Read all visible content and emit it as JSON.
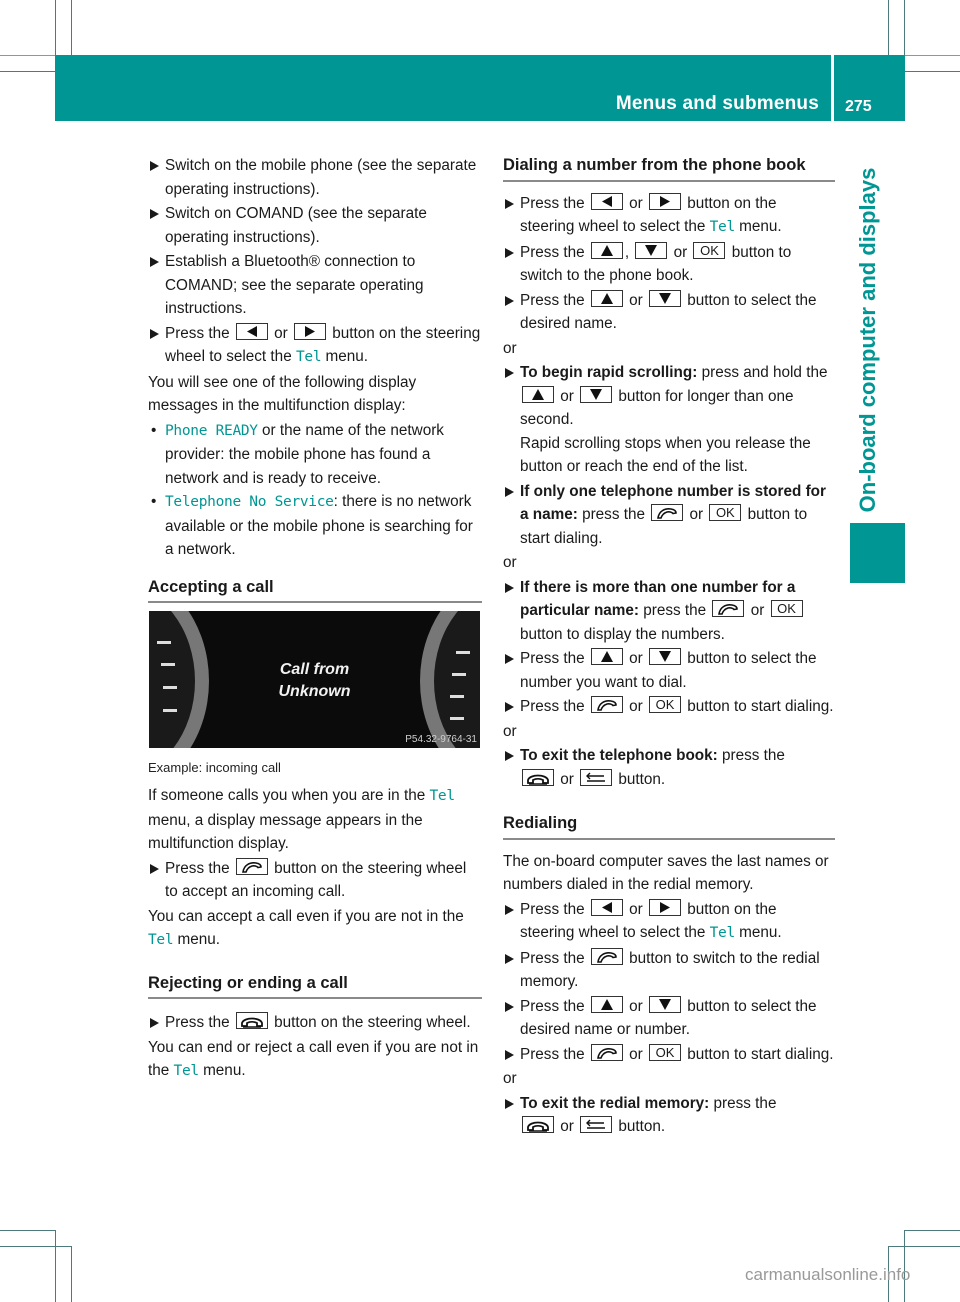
{
  "header": {
    "title": "Menus and submenus",
    "page_number": "275",
    "side_label": "On-board computer and displays",
    "accent_color": "#009693"
  },
  "left": {
    "steps_intro": [
      "Switch on the mobile phone (see the separate operating instructions).",
      "Switch on COMAND (see the separate operating instructions).",
      "Establish a Bluetooth® connection to COMAND; see the separate operating instructions."
    ],
    "select_tel": {
      "pre": "Press the",
      "or": "or",
      "post1": "button on the steering wheel to select the",
      "tel": "Tel",
      "post2": "menu."
    },
    "display_intro": "You will see one of the following display messages in the multifunction display:",
    "messages": [
      {
        "code": "Phone READY",
        "text": " or the name of the network provider: the mobile phone has found a network and is ready to receive."
      },
      {
        "code": "Telephone No Service",
        "text": ": there is no network available or the mobile phone is searching for a network."
      }
    ],
    "accepting": {
      "heading": "Accepting a call",
      "figure": {
        "line1": "Call from",
        "line2": "Unknown",
        "code": "P54.32-9764-31"
      },
      "caption": "Example: incoming call",
      "p1_pre": "If someone calls you when you are in the",
      "p1_tel": "Tel",
      "p1_post": "menu, a display message appears in the multifunction display.",
      "step_pre": "Press the",
      "step_post": "button on the steering wheel to accept an incoming call.",
      "p2_pre": "You can accept a call even if you are not in the",
      "p2_tel": "Tel",
      "p2_post": "menu."
    },
    "rejecting": {
      "heading": "Rejecting or ending a call",
      "step_pre": "Press the",
      "step_post": "button on the steering wheel.",
      "p_pre": "You can end or reject a call even if you are not in the",
      "p_tel": "Tel",
      "p_post": "menu."
    }
  },
  "right": {
    "dialing": {
      "heading": "Dialing a number from the phone book",
      "s1_pre": "Press the",
      "s1_or": "or",
      "s1_post": "button on the steering wheel to select the",
      "s1_tel": "Tel",
      "s1_end": "menu.",
      "s2_pre": "Press the",
      "s2_comma": ",",
      "s2_or": "or",
      "s2_post": "button to switch to the phone book.",
      "s3_pre": "Press the",
      "s3_or": "or",
      "s3_post": "button to select the desired name.",
      "or1": "or",
      "s4_bold": "To begin rapid scrolling:",
      "s4_pre": "press and hold the",
      "s4_or": "or",
      "s4_post": "button for longer than one second.",
      "s4_note": "Rapid scrolling stops when you release the button or reach the end of the list.",
      "s5_bold": "If only one telephone number is stored for a name:",
      "s5_pre": "press the",
      "s5_or": "or",
      "s5_post": "button to start dialing.",
      "or2": "or",
      "s6_bold": "If there is more than one number for a particular name:",
      "s6_pre": "press the",
      "s6_or": "or",
      "s6_post": "button to display the numbers.",
      "s7_pre": "Press the",
      "s7_or": "or",
      "s7_post": "button to select the number you want to dial.",
      "s8_pre": "Press the",
      "s8_or": "or",
      "s8_post": "button to start dialing.",
      "or3": "or",
      "s9_bold": "To exit the telephone book:",
      "s9_pre": "press the",
      "s9_or": "or",
      "s9_post": "button."
    },
    "redialing": {
      "heading": "Redialing",
      "intro": "The on-board computer saves the last names or numbers dialed in the redial memory.",
      "s1_pre": "Press the",
      "s1_or": "or",
      "s1_post": "button on the steering wheel to select the",
      "s1_tel": "Tel",
      "s1_end": "menu.",
      "s2_pre": "Press the",
      "s2_post": "button to switch to the redial memory.",
      "s3_pre": "Press the",
      "s3_or": "or",
      "s3_post": "button to select the desired name or number.",
      "s4_pre": "Press the",
      "s4_or": "or",
      "s4_post": "button to start dialing.",
      "or1": "or",
      "s5_bold": "To exit the redial memory:",
      "s5_pre": "press the",
      "s5_or": "or",
      "s5_post": "button."
    }
  },
  "keys": {
    "ok": "OK"
  },
  "watermark": "carmanualsonline.info"
}
